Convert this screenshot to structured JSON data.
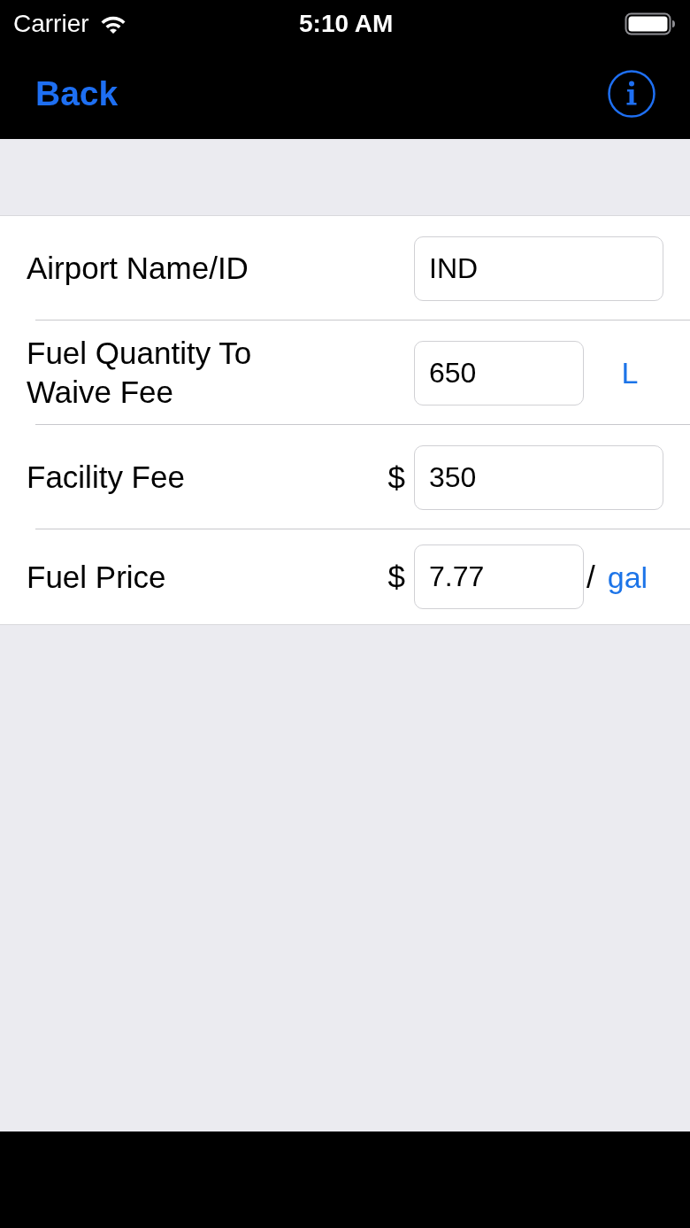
{
  "status_bar": {
    "carrier": "Carrier",
    "time": "5:10 AM"
  },
  "nav_bar": {
    "back": "Back"
  },
  "form": {
    "rows": [
      {
        "label": "Airport Name/ID",
        "value": "IND"
      },
      {
        "label": "Fuel Quantity To Waive Fee",
        "value": "650",
        "unit": "L"
      },
      {
        "label": "Facility Fee",
        "prefix": "$",
        "value": "350"
      },
      {
        "label": "Fuel Price",
        "prefix": "$",
        "value": "7.77",
        "separator": "/",
        "unit": "gal"
      }
    ]
  }
}
